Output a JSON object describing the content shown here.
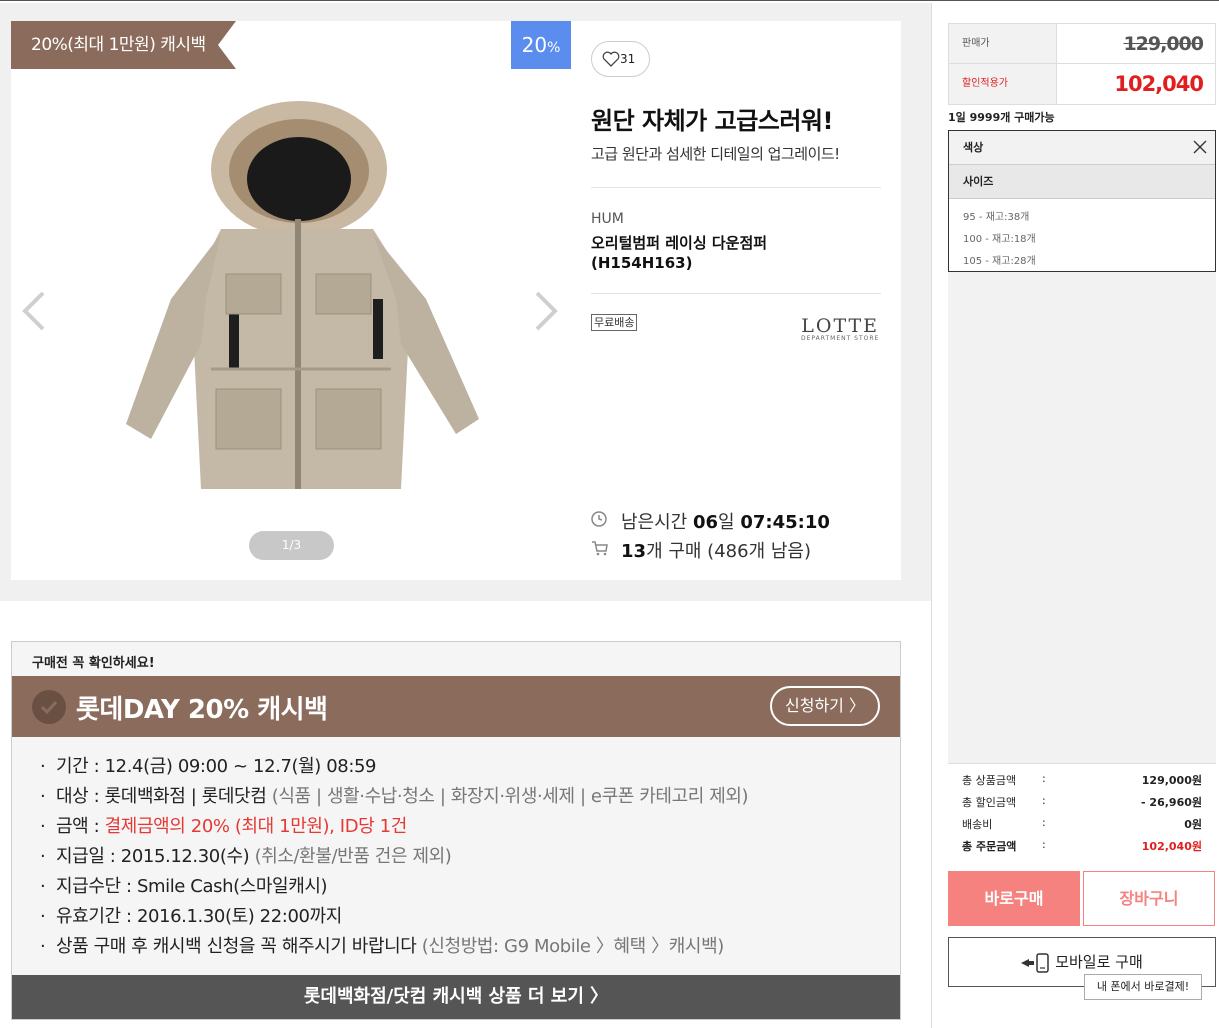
{
  "product": {
    "cashback_ribbon": "20%(최대 1만원) 캐시백",
    "discount_badge_number": "20",
    "discount_badge_unit": "%",
    "like_count": "31",
    "headline": "원단 자체가 고급스러워!",
    "subheadline": "고급 원단과 섬세한 디테일의 업그레이드!",
    "brand": "HUM",
    "name": "오리털범퍼 레이싱 다운점퍼 (H154H163)",
    "free_shipping": "무료배송",
    "store_logo_main": "LOTTE",
    "store_logo_sub": "DEPARTMENT STORE",
    "pager": "1/3",
    "timer_label": "남은시간",
    "timer_days": "06",
    "timer_days_unit": "일",
    "timer_time": "07:45:10",
    "sold_count": "13",
    "sold_suffix": "개 구매 (486개 남음)"
  },
  "notice": {
    "label": "구매전 꼭 확인하세요!",
    "title": "롯데DAY 20% 캐시백",
    "apply_button": "신청하기 〉",
    "items": [
      {
        "main": "기간 : 12.4(금) 09:00 ~ 12.7(월) 08:59",
        "extra": ""
      },
      {
        "main": "대상 : 롯데백화점 | 롯데닷컴 ",
        "extra": "(식품 | 생활·수납·청소 | 화장지·위생·세제 | e쿠폰 카테고리 제외)"
      },
      {
        "main": "금액 : ",
        "red": "결제금액의 20% (최대 1만원), ID당 1건"
      },
      {
        "main": "지급일 : 2015.12.30(수) ",
        "extra": "(취소/환불/반품 건은 제외)"
      },
      {
        "main": "지급수단 : Smile Cash(스마일캐시)",
        "extra": ""
      },
      {
        "main": "유효기간 : 2016.1.30(토)  22:00까지",
        "extra": ""
      },
      {
        "main": "상품 구매 후 캐시백 신청을 꼭 해주시기 바랍니다 ",
        "extra": "(신청방법: G9 Mobile 〉혜택 〉캐시백)"
      }
    ],
    "more_button": "롯데백화점/닷컴 캐시백 상품 더 보기 〉"
  },
  "panel": {
    "sale_label": "판매가",
    "sale_price": "129,000",
    "discount_label": "할인적용가",
    "discount_price": "102,040",
    "purchase_limit": "1일 9999개 구매가능",
    "option_color": "색상",
    "option_size": "사이즈",
    "size_options": [
      "95 - 재고:38개",
      "100 - 재고:18개",
      "105 - 재고:28개"
    ],
    "summary": [
      {
        "label": "총 상품금액",
        "colon": ":",
        "value": "129,000원"
      },
      {
        "label": "총 할인금액",
        "colon": ":",
        "value": "- 26,960원"
      },
      {
        "label": "배송비",
        "colon": ":",
        "value": "0원"
      },
      {
        "label": "총 주문금액",
        "colon": ":",
        "value": "102,040원"
      }
    ],
    "buy_button": "바로구매",
    "cart_button": "장바구니",
    "mobile_button": "모바일로 구매",
    "mobile_tip": "내 폰에서 바로결제!"
  },
  "colors": {
    "accent_brown": "#8b6c5c",
    "badge_blue": "#5b8def",
    "price_red": "#e02020",
    "buy_pink": "#f5827f"
  }
}
